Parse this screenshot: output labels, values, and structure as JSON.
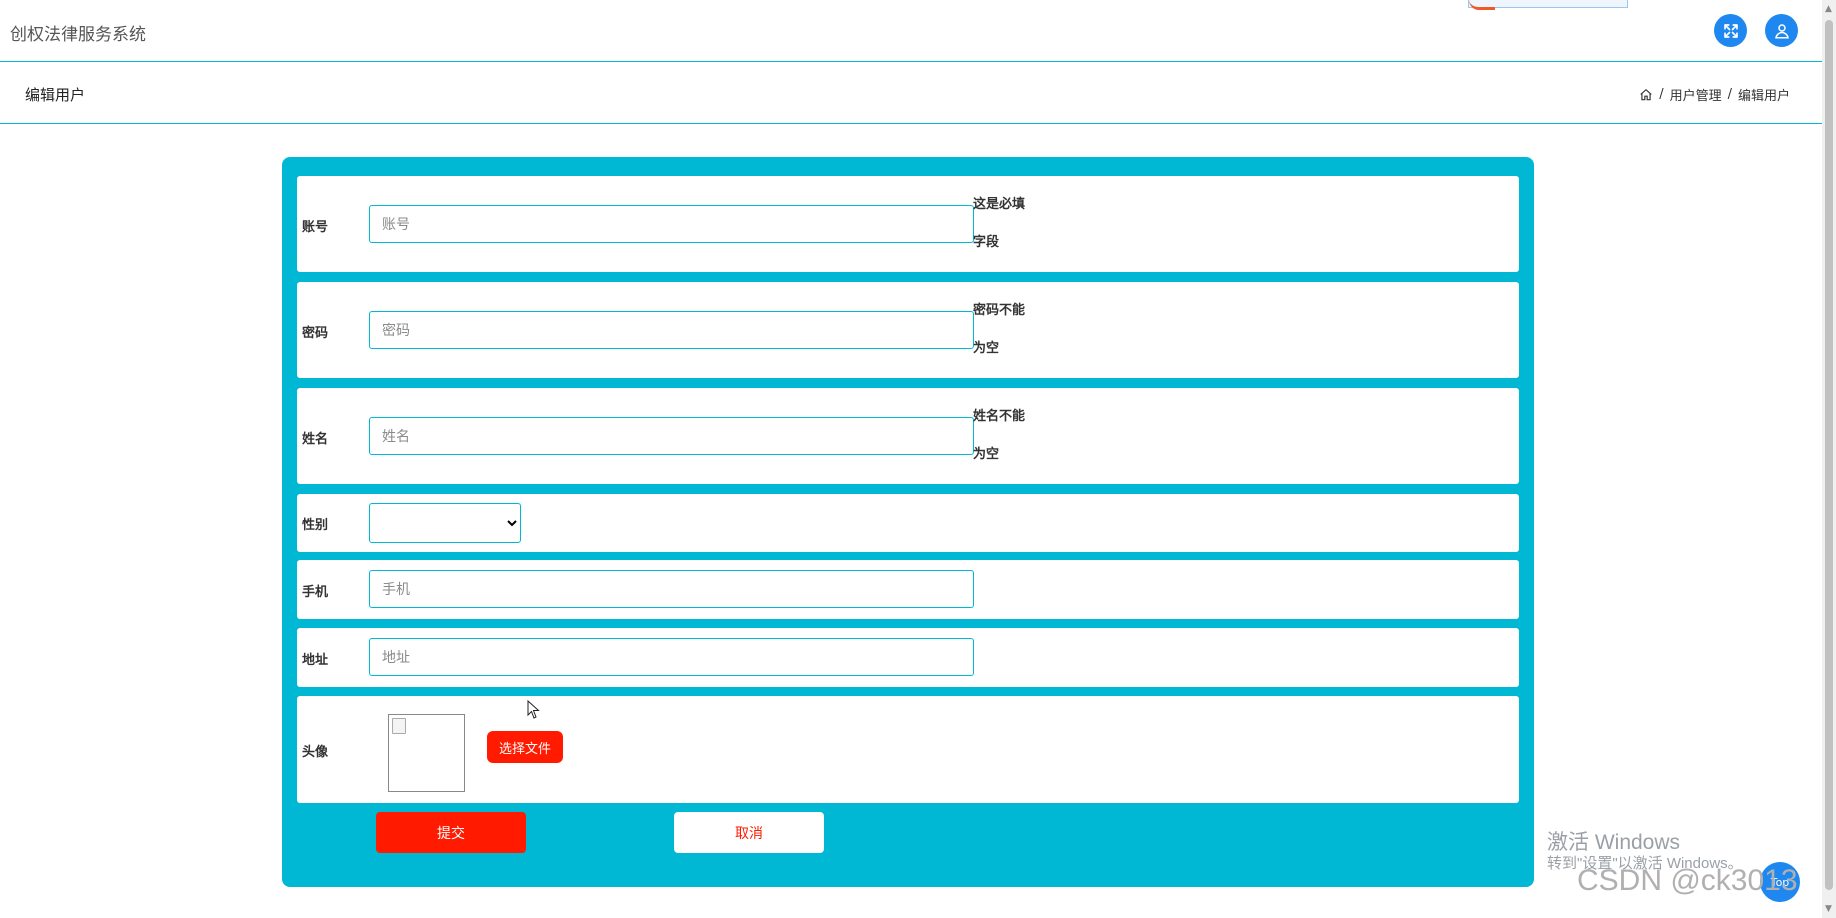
{
  "app": {
    "title": "创权法律服务系统"
  },
  "header": {
    "expand_icon": "expand-arrows-icon",
    "user_icon": "user-icon",
    "accent_color": "#1e88f0"
  },
  "page": {
    "title": "编辑用户",
    "breadcrumb": {
      "home_icon": "home-icon",
      "separator": "/",
      "parent": "用户管理",
      "current": "编辑用户"
    }
  },
  "form": {
    "panel_color": "#00b8d4",
    "account": {
      "label": "账号",
      "placeholder": "账号",
      "value": "",
      "hint_line1": "这是必填",
      "hint_line2": "字段"
    },
    "password": {
      "label": "密码",
      "placeholder": "密码",
      "value": "",
      "hint_line1": "密码不能",
      "hint_line2": "为空"
    },
    "name": {
      "label": "姓名",
      "placeholder": "姓名",
      "value": "",
      "hint_line1": "姓名不能",
      "hint_line2": "为空"
    },
    "gender": {
      "label": "性别",
      "selected": ""
    },
    "phone": {
      "label": "手机",
      "placeholder": "手机",
      "value": ""
    },
    "address": {
      "label": "地址",
      "placeholder": "地址",
      "value": ""
    },
    "avatar": {
      "label": "头像",
      "choose_file_label": "选择文件"
    },
    "submit_label": "提交",
    "cancel_label": "取消",
    "button_color": "#ff1a00"
  },
  "overlay": {
    "activation_line1": "激活 Windows",
    "activation_line2": "转到\"设置\"以激活 Windows。",
    "csdn_watermark": "CSDN @ck3013",
    "top_button_label": "Top"
  }
}
